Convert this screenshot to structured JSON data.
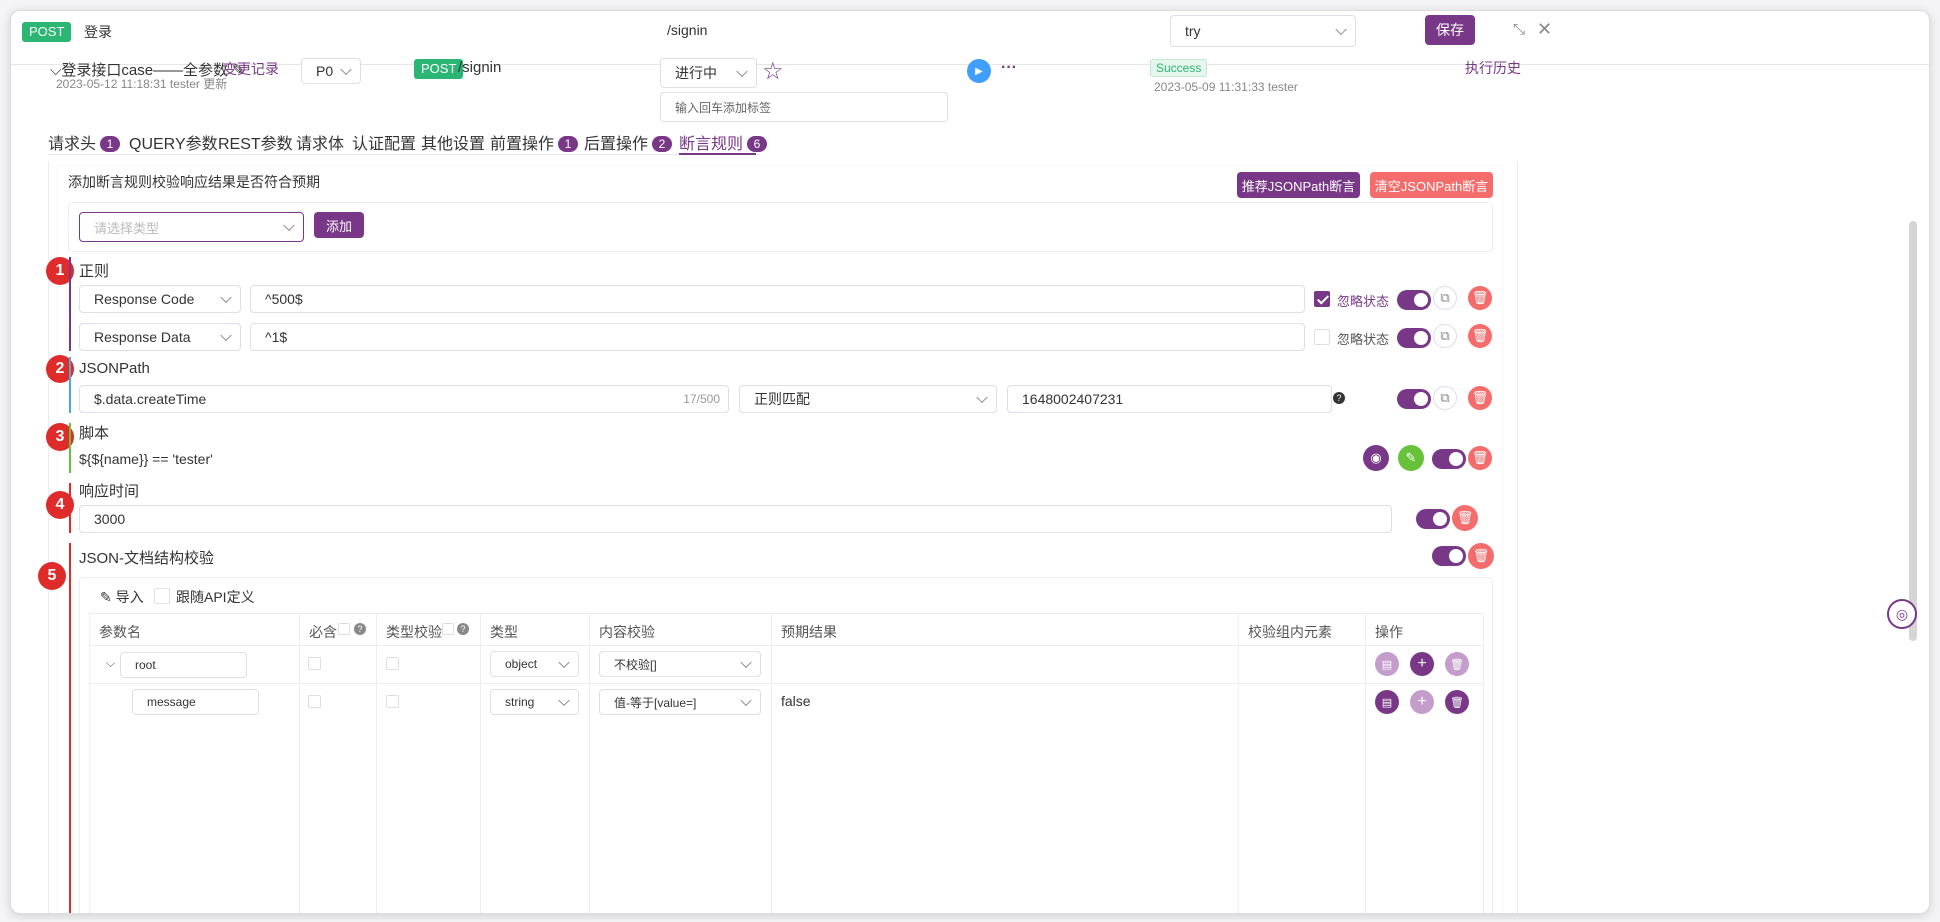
{
  "header": {
    "method": "POST",
    "title": "登录",
    "path": "/signin",
    "env_value": "try",
    "save_label": "保存"
  },
  "case": {
    "name": "登录接口case——全参数",
    "meta": "2023-05-12 11:18:31 tester 更新",
    "change_log": "变更记录",
    "priority": "P0",
    "method": "POST",
    "path": "/signin",
    "status": "进行中",
    "tag_placeholder": "输入回车添加标签",
    "result": "Success",
    "result_meta": "2023-05-09 11:31:33 tester",
    "history": "执行历史"
  },
  "tabs": [
    {
      "label": "请求头",
      "badge": "1"
    },
    {
      "label": "QUERY参数"
    },
    {
      "label": "REST参数"
    },
    {
      "label": "请求体"
    },
    {
      "label": "认证配置"
    },
    {
      "label": "其他设置"
    },
    {
      "label": "前置操作",
      "badge": "1"
    },
    {
      "label": "后置操作",
      "badge": "2"
    },
    {
      "label": "断言规则",
      "badge": "6"
    }
  ],
  "assert": {
    "desc": "添加断言规则校验响应结果是否符合预期",
    "recommend_btn": "推荐JSONPath断言",
    "clear_btn": "清空JSONPath断言",
    "type_placeholder": "请选择类型",
    "add_btn": "添加"
  },
  "sections": {
    "regex": {
      "num": "1",
      "title": "正则",
      "rows": [
        {
          "type": "Response Code",
          "value": "^500$",
          "ignore": "忽略状态",
          "checked": true
        },
        {
          "type": "Response Data",
          "value": "^1$",
          "ignore": "忽略状态",
          "checked": false
        }
      ]
    },
    "jsonpath": {
      "num": "2",
      "title": "JSONPath",
      "expr": "$.data.createTime",
      "count": "17/500",
      "match": "正则匹配",
      "value": "1648002407231",
      "help": "?"
    },
    "script": {
      "num": "3",
      "title": "脚本",
      "code": "${${name}} == 'tester'"
    },
    "response_time": {
      "num": "4",
      "title": "响应时间",
      "value": "3000"
    },
    "json_schema": {
      "num": "5",
      "title": "JSON-文档结构校验",
      "import": "导入",
      "follow": "跟随API定义",
      "columns": [
        "参数名",
        "必含",
        "类型校验",
        "类型",
        "内容校验",
        "预期结果",
        "校验组内元素",
        "操作"
      ],
      "rows": [
        {
          "name": "root",
          "type": "object",
          "check": "不校验[]",
          "expected": ""
        },
        {
          "name": "message",
          "type": "string",
          "check": "值-等于[value=]",
          "expected": "false"
        }
      ]
    }
  },
  "colors": {
    "accent": "#783887",
    "danger": "#f56c6c",
    "success": "#2bb673"
  }
}
